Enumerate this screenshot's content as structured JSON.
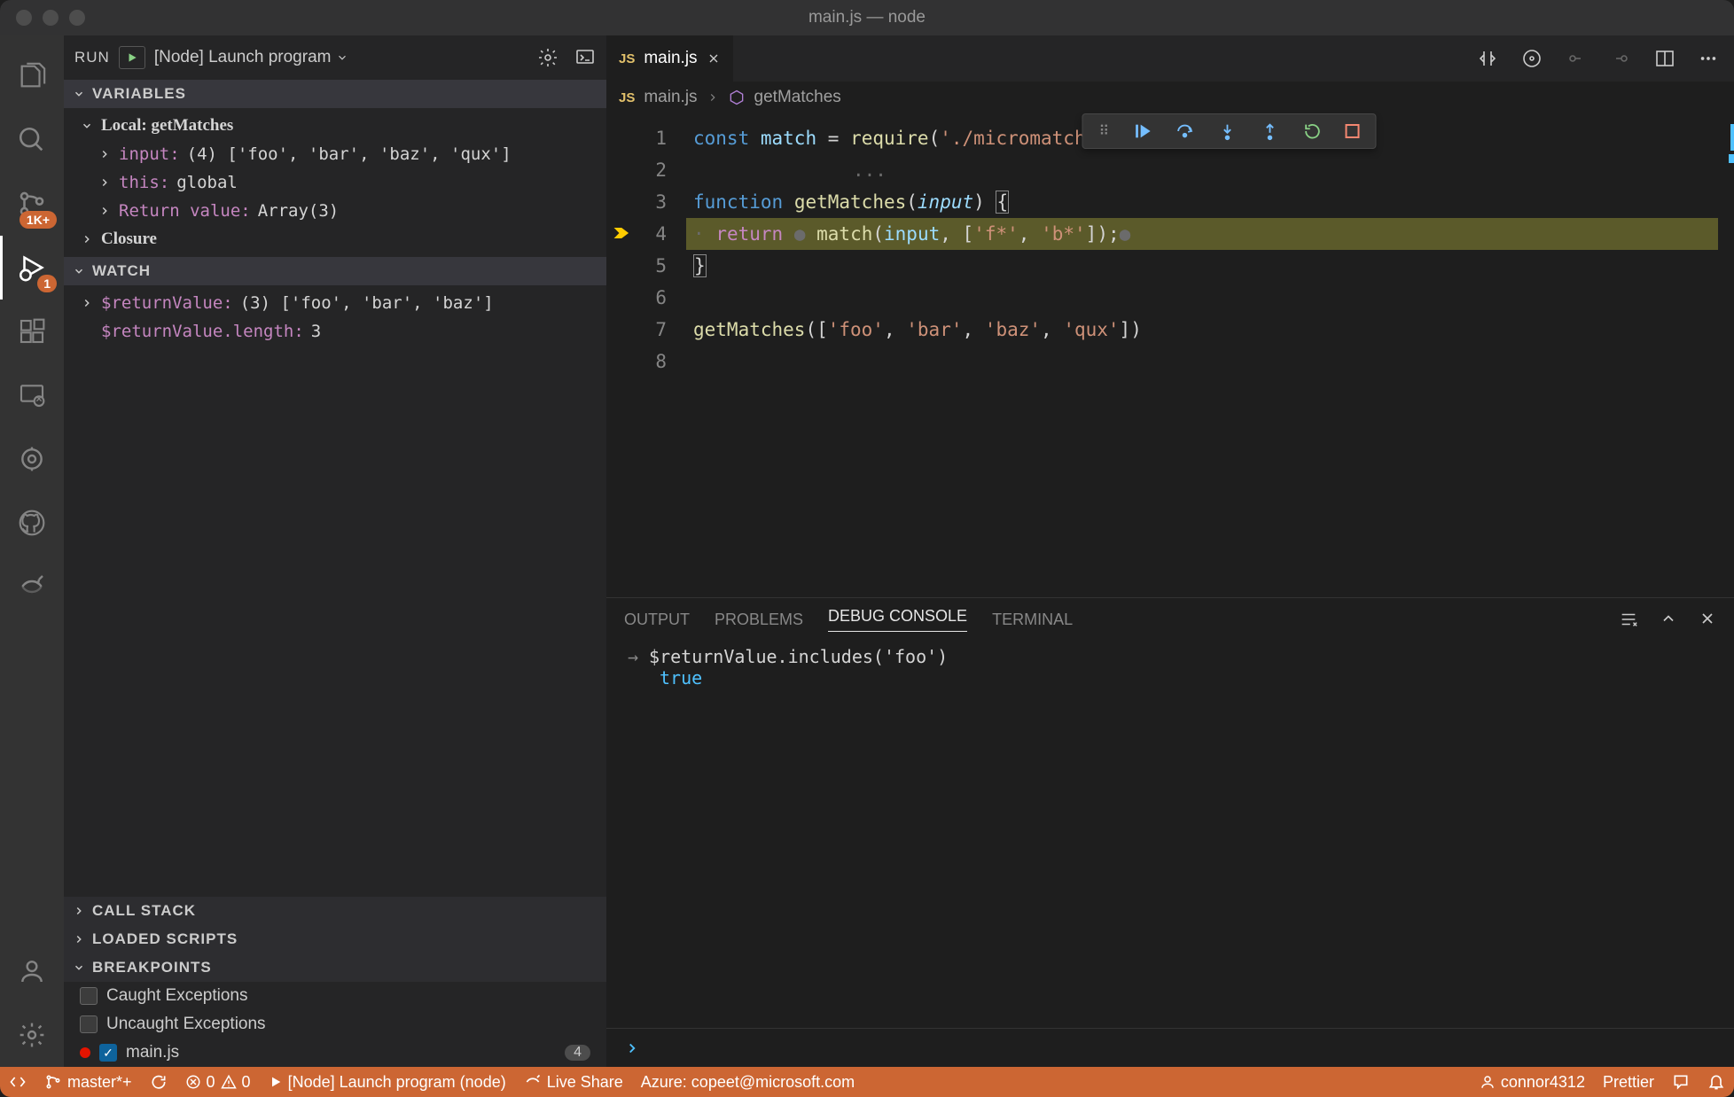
{
  "window": {
    "title": "main.js — node"
  },
  "activity": {
    "badges": {
      "scm": "1K+",
      "debug": "1"
    }
  },
  "run": {
    "label": "RUN",
    "config": "[Node] Launch program"
  },
  "variables": {
    "title": "VARIABLES",
    "scope": "Local: getMatches",
    "rows": [
      {
        "name": "input:",
        "value": "(4) ['foo', 'bar', 'baz', 'qux']"
      },
      {
        "name": "this:",
        "value": "global"
      },
      {
        "name": "Return value:",
        "value": "Array(3)"
      }
    ],
    "closure": "Closure"
  },
  "watch": {
    "title": "WATCH",
    "rows": [
      {
        "name": "$returnValue:",
        "value": "(3) ['foo', 'bar', 'baz']"
      },
      {
        "name": "$returnValue.length:",
        "value": "3"
      }
    ]
  },
  "callstack": {
    "title": "CALL STACK"
  },
  "loaded": {
    "title": "LOADED SCRIPTS"
  },
  "breakpoints": {
    "title": "BREAKPOINTS",
    "items": [
      {
        "label": "Caught Exceptions",
        "checked": false
      },
      {
        "label": "Uncaught Exceptions",
        "checked": false
      }
    ],
    "file": {
      "label": "main.js",
      "count": "4"
    }
  },
  "tab": {
    "filename": "main.js"
  },
  "breadcrumb": {
    "file": "main.js",
    "symbol": "getMatches"
  },
  "code": {
    "lines": [
      "const match = require('./micromatch');",
      "",
      "function getMatches(input) {",
      "  return  match(input, ['f*', 'b*']);",
      "}",
      "",
      "getMatches(['foo', 'bar', 'baz', 'qux'])",
      ""
    ]
  },
  "panel": {
    "tabs": [
      "OUTPUT",
      "PROBLEMS",
      "DEBUG CONSOLE",
      "TERMINAL"
    ],
    "active": 2,
    "console_input": "$returnValue.includes('foo')",
    "console_result": "true"
  },
  "statusbar": {
    "branch": "master*+",
    "errors": "0",
    "warnings": "0",
    "debug": "[Node] Launch program (node)",
    "liveshare": "Live Share",
    "azure": "Azure: copeet@microsoft.com",
    "user": "connor4312",
    "prettier": "Prettier"
  }
}
